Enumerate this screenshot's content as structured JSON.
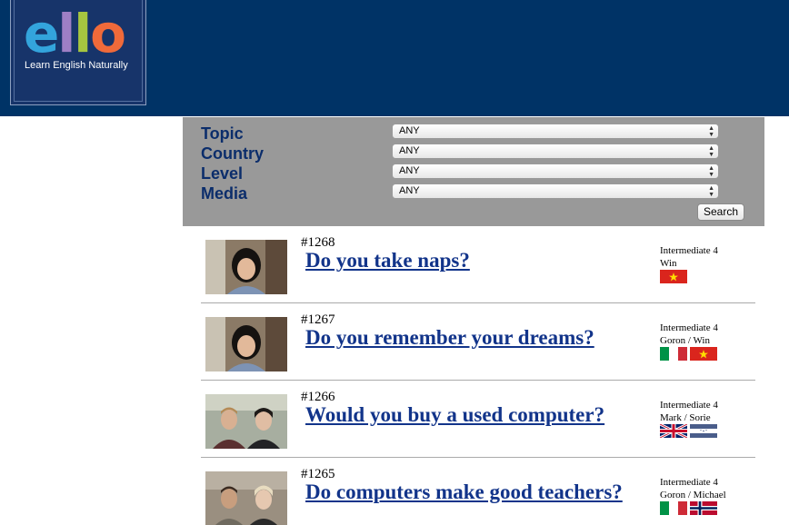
{
  "brand": {
    "logo_letters": [
      "e",
      "l",
      "l",
      "o"
    ],
    "tagline": "Learn English Naturally",
    "colors": {
      "header_bg": "#003366",
      "e": "#33a4dc",
      "l1": "#9e7fc5",
      "l2": "#a6c640",
      "o": "#f06a3a"
    }
  },
  "search": {
    "filters": [
      {
        "label": "Topic",
        "value": "ANY"
      },
      {
        "label": "Country",
        "value": "ANY"
      },
      {
        "label": "Level",
        "value": "ANY"
      },
      {
        "label": "Media",
        "value": "ANY"
      }
    ],
    "button_label": "Search"
  },
  "lessons": [
    {
      "number": "#1268",
      "title": "Do you take naps?",
      "level": "Intermediate 4",
      "speakers": "Win",
      "flags": [
        "vietnam-flag"
      ]
    },
    {
      "number": "#1267",
      "title": "Do you remember your dreams?",
      "level": "Intermediate 4",
      "speakers": "Goron / Win",
      "flags": [
        "italy-flag",
        "vietnam-flag"
      ]
    },
    {
      "number": "#1266",
      "title": "Would you buy a used computer?",
      "level": "Intermediate 4",
      "speakers": "Mark / Sorie",
      "flags": [
        "uk-flag",
        "honduras-flag"
      ]
    },
    {
      "number": "#1265",
      "title": "Do computers make good teachers?",
      "level": "Intermediate 4",
      "speakers": "Goron / Michael",
      "flags": [
        "italy-flag",
        "norway-flag"
      ]
    }
  ]
}
